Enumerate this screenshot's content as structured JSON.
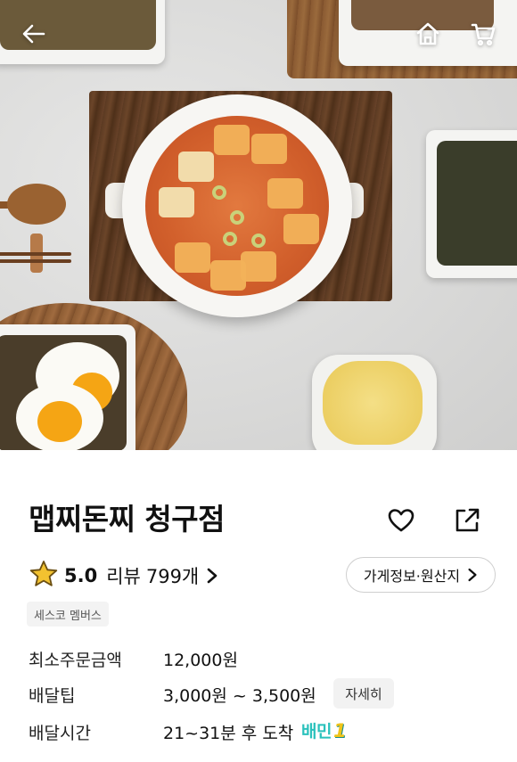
{
  "topbar": {
    "back_icon": "arrow-left-icon",
    "home_icon": "home-icon",
    "cart_icon": "cart-icon"
  },
  "hero": {
    "description_icon": "food-photo"
  },
  "store": {
    "name": "맵찌돈찌 청구점",
    "like_icon": "heart-outline-icon",
    "share_icon": "share-icon",
    "rating": "5.0",
    "review_label": "리뷰",
    "review_count": "799개",
    "info_button_label": "가게정보·원산지",
    "tag": "세스코 멤버스"
  },
  "details": {
    "min_order_label": "최소주문금액",
    "min_order_value": "12,000원",
    "delivery_tip_label": "배달팁",
    "delivery_tip_value": "3,000원 ~ 3,500원",
    "delivery_tip_detail": "자세히",
    "delivery_time_label": "배달시간",
    "delivery_time_value": "21~31분 후 도착",
    "badge_text": "배민",
    "badge_number": "1"
  },
  "colors": {
    "star": "#f2c230",
    "star_stroke": "#6b4f12",
    "badge": "#2ac1bc",
    "badge_one": "#f0c419"
  }
}
